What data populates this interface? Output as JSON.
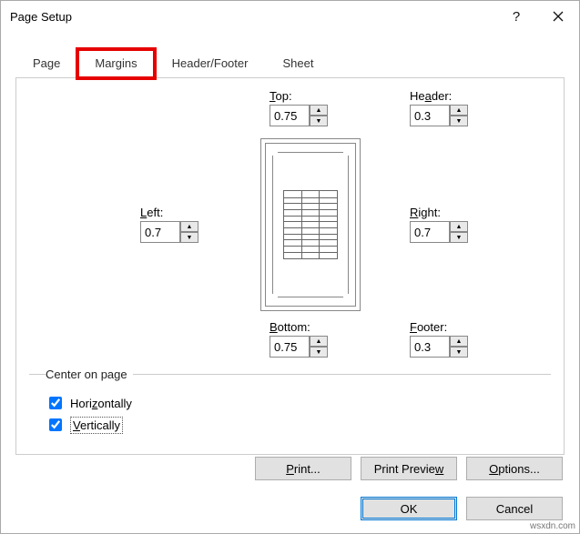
{
  "window": {
    "title": "Page Setup"
  },
  "tabs": {
    "page": "Page",
    "margins": "Margins",
    "hf": "Header/Footer",
    "sheet": "Sheet",
    "active": "margins"
  },
  "margins": {
    "top": {
      "label": "Top:",
      "value": "0.75"
    },
    "header": {
      "label": "Header:",
      "value": "0.3"
    },
    "left": {
      "label": "Left:",
      "value": "0.7"
    },
    "right": {
      "label": "Right:",
      "value": "0.7"
    },
    "bottom": {
      "label": "Bottom:",
      "value": "0.75"
    },
    "footer": {
      "label": "Footer:",
      "value": "0.3"
    }
  },
  "center": {
    "legend": "Center on page",
    "horizontally": {
      "label": "Horizontally",
      "checked": true
    },
    "vertically": {
      "label": "Vertically",
      "checked": true
    }
  },
  "buttons": {
    "print": "Print...",
    "preview": "Print Preview",
    "options": "Options...",
    "ok": "OK",
    "cancel": "Cancel"
  },
  "watermark": "wsxdn.com"
}
